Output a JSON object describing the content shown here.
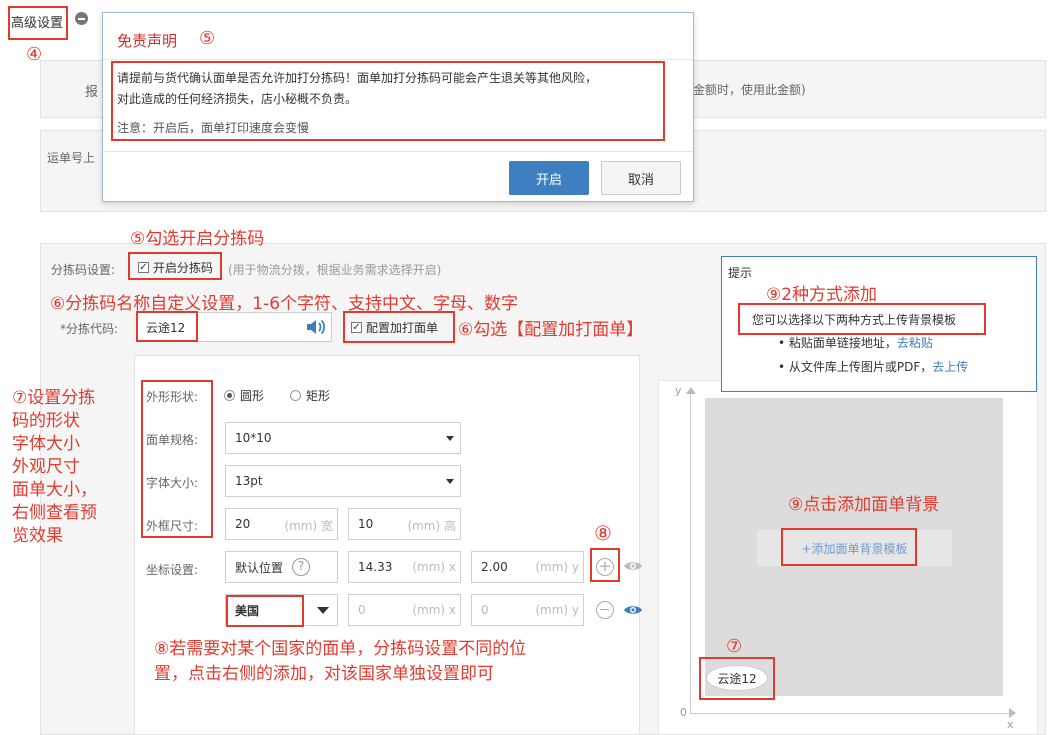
{
  "header": {
    "title": "高级设置",
    "collapse_icon": "minus-circle-icon",
    "step_label": "④"
  },
  "background": {
    "row1_label_frag": "报",
    "row1_tail_text": "金额时，使用此金额)",
    "row2_label_frag": "运单号上"
  },
  "dialog": {
    "title": "免责声明",
    "step_label": "⑤",
    "body_line1": "请提前与货代确认面单是否允许加打分拣码！面单加打分拣码可能会产生退关等其他风险，",
    "body_line2": "对此造成的任何经济损失，店小秘概不负责。",
    "note": "注意：开启后，面单打印速度会变慢",
    "confirm_label": "开启",
    "cancel_label": "取消"
  },
  "annotations": {
    "a5_check": "⑤勾选开启分拣码",
    "a6_name": "⑥分拣码名称自定义设置，1-6个字符、支持中文、字母、数字",
    "a6_config": "⑥勾选【配置加打面单】",
    "a7_left": [
      "⑦设置分拣",
      "码的形状",
      "字体大小",
      "外观尺寸",
      "面单大小，",
      "右侧查看预",
      "览效果"
    ],
    "a7_preview": "⑦",
    "a8_num": "⑧",
    "a8_text_line1": "⑧若需要对某个国家的面单，分拣码设置不同的位",
    "a8_text_line2": "置，点击右侧的添加，对该国家单独设置即可",
    "a9_methods": "⑨2种方式添加",
    "a9_click": "⑨点击添加面单背景"
  },
  "sort_code": {
    "settings_label": "分拣码设置:",
    "enable_label": "开启分拣码",
    "enable_hint": "(用于物流分拨，根据业务需求选择开启)",
    "code_label": "*分拣代码:",
    "code_value": "云途12",
    "speaker_icon": "speaker-icon",
    "config_label": "配置加打面单"
  },
  "form": {
    "shape_label": "外形形状:",
    "shape_options": [
      "圆形",
      "矩形"
    ],
    "size_label": "面单规格:",
    "size_value": "10*10",
    "font_label": "字体大小:",
    "font_value": "13pt",
    "frame_label": "外框尺寸:",
    "frame_width": "20",
    "frame_width_unit": "(mm) 宽",
    "frame_height": "10",
    "frame_height_unit": "(mm) 高",
    "coord_label": "坐标设置:",
    "default_pos": "默认位置",
    "coord_x": "14.33",
    "coord_x_unit": "(mm) x",
    "coord_y": "2.00",
    "coord_y_unit": "(mm) y",
    "country_value": "美国",
    "country_x": "0",
    "country_y": "0",
    "help_icon": "question-circle-icon",
    "add_icon": "plus-circle-icon",
    "remove_icon": "minus-circle-icon",
    "eye_icon": "eye-icon"
  },
  "tip": {
    "title": "提示",
    "main": "您可以选择以下两种方式上传背景模板",
    "item1_prefix": "粘贴面单链接地址，",
    "item1_link": "去粘贴",
    "item2_prefix": "从文件库上传图片或PDF，",
    "item2_link": "去上传"
  },
  "preview": {
    "y_axis": "y",
    "x_axis": "x",
    "origin": "0",
    "add_bg_label": "+添加面单背景模板",
    "badge_text": "云途12"
  },
  "colors": {
    "annotation": "#e23a2e",
    "primary_button": "#3e7fc1",
    "link": "#3e7fc1",
    "dialog_title": "#c9302c"
  }
}
